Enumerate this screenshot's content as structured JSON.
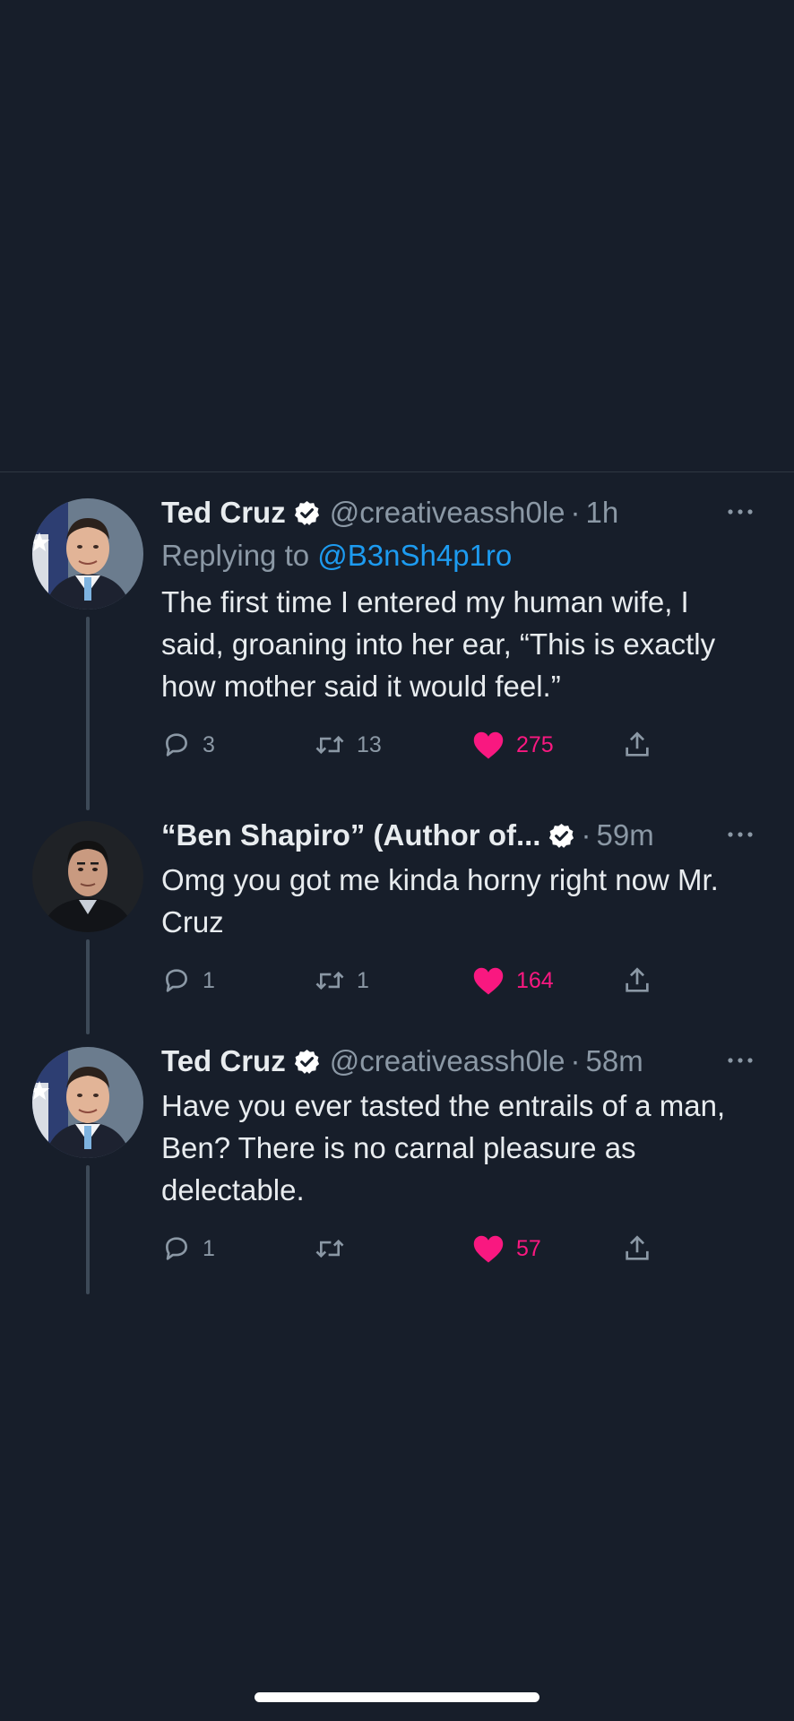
{
  "theme": {
    "background": "#171e2a",
    "text": "#e8ecef",
    "secondary_text": "#8b98a5",
    "link": "#1d9bf0",
    "like": "#f91880",
    "verified_badge": "#ffffff"
  },
  "tweets": [
    {
      "name": "Ted Cruz",
      "verified": true,
      "handle": "@creativeassh0le",
      "separator": "·",
      "time": "1h",
      "replying_prefix": "Replying to",
      "replying_to": "@B3nSh4p1ro",
      "text": "The first time I entered my human wife, I said, groaning into her ear, “This is exactly how mother said it would feel.”",
      "replies": "3",
      "retweets": "13",
      "likes": "275",
      "liked": true,
      "avatar": "ted-cruz-avatar"
    },
    {
      "name": "“Ben Shapiro” (Author of...",
      "verified": true,
      "handle": "",
      "separator": "·",
      "time": "59m",
      "text": "Omg you got me kinda horny right now Mr. Cruz",
      "replies": "1",
      "retweets": "1",
      "likes": "164",
      "liked": true,
      "avatar": "ben-shapiro-avatar"
    },
    {
      "name": "Ted Cruz",
      "verified": true,
      "handle": "@creativeassh0le",
      "separator": "·",
      "time": "58m",
      "text": "Have you ever tasted the entrails of a man, Ben? There is no carnal pleasure as delectable.",
      "replies": "1",
      "retweets": "",
      "likes": "57",
      "liked": true,
      "avatar": "ted-cruz-avatar"
    }
  ],
  "icons": {
    "reply": "speech-bubble-icon",
    "retweet": "retweet-arrows-icon",
    "like": "heart-icon",
    "share": "share-upload-icon",
    "more": "more-dots-icon",
    "verified": "verified-check-badge-icon"
  }
}
